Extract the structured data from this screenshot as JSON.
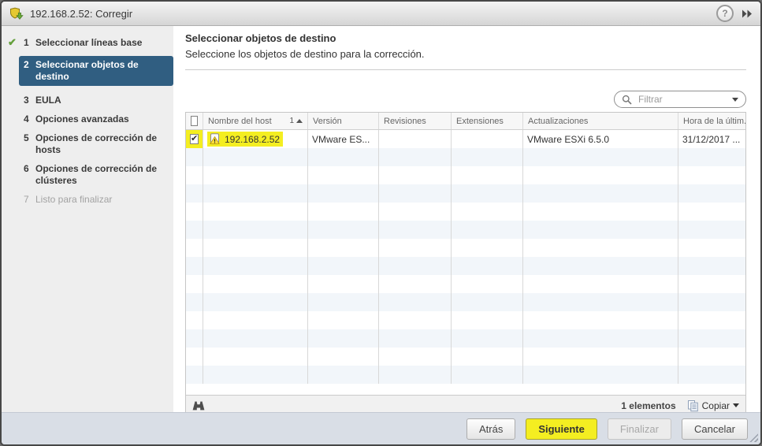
{
  "window": {
    "title": "192.168.2.52: Corregir",
    "help_icon": "?"
  },
  "sidebar": {
    "steps": [
      {
        "num": "1",
        "label": "Seleccionar líneas base",
        "state": "done"
      },
      {
        "num": "2",
        "label": "Seleccionar objetos de destino",
        "state": "active"
      },
      {
        "num": "3",
        "label": "EULA",
        "state": "enabled"
      },
      {
        "num": "4",
        "label": "Opciones avanzadas",
        "state": "enabled"
      },
      {
        "num": "5",
        "label": "Opciones de corrección de hosts",
        "state": "enabled"
      },
      {
        "num": "6",
        "label": "Opciones de corrección de clústeres",
        "state": "enabled"
      },
      {
        "num": "7",
        "label": "Listo para finalizar",
        "state": "disabled"
      }
    ]
  },
  "main": {
    "title": "Seleccionar objetos de destino",
    "subtitle": "Seleccione los objetos de destino para la corrección.",
    "filter": {
      "placeholder": "Filtrar"
    },
    "table": {
      "columns": [
        "Nombre del host",
        "Versión",
        "Revisiones",
        "Extensiones",
        "Actualizaciones",
        "Hora de la últim..."
      ],
      "sort_num": "1",
      "rows": [
        {
          "checked": true,
          "highlighted": true,
          "host": "192.168.2.52",
          "version": "VMware ES...",
          "revisions": "",
          "extensions": "",
          "updates": "VMware ESXi 6.5.0",
          "last_time": "31/12/2017 ..."
        }
      ],
      "empty_row_count": 13,
      "footer": {
        "count_label": "1 elementos",
        "copy_label": "Copiar"
      }
    }
  },
  "buttons": {
    "back": "Atrás",
    "next": "Siguiente",
    "finish": "Finalizar",
    "cancel": "Cancelar"
  },
  "colors": {
    "highlight": "#f4ee21",
    "active_step_bg": "#305e81"
  }
}
